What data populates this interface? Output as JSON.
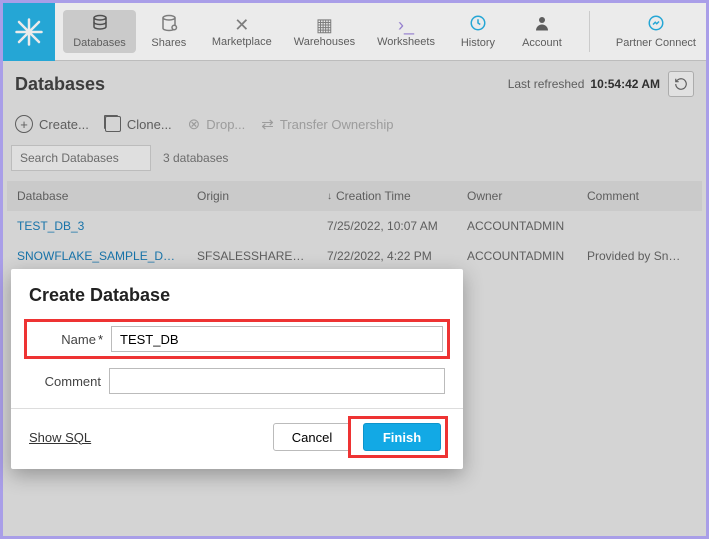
{
  "nav": {
    "items": [
      {
        "label": "Databases",
        "icon": "database-icon",
        "active": true
      },
      {
        "label": "Shares",
        "icon": "share-icon"
      },
      {
        "label": "Marketplace",
        "icon": "marketplace-icon"
      },
      {
        "label": "Warehouses",
        "icon": "warehouse-icon"
      },
      {
        "label": "Worksheets",
        "icon": "worksheet-icon"
      },
      {
        "label": "History",
        "icon": "history-icon"
      },
      {
        "label": "Account",
        "icon": "account-icon"
      }
    ],
    "partner": {
      "label": "Partner Connect"
    }
  },
  "header": {
    "title": "Databases",
    "last_refreshed_label": "Last refreshed",
    "last_refreshed_time": "10:54:42 AM"
  },
  "toolbar": {
    "create": "Create...",
    "clone": "Clone...",
    "drop": "Drop...",
    "transfer": "Transfer Ownership"
  },
  "search": {
    "placeholder": "Search Databases",
    "count_label": "3 databases"
  },
  "table": {
    "columns": {
      "database": "Database",
      "origin": "Origin",
      "creation_time": "Creation Time",
      "owner": "Owner",
      "comment": "Comment"
    },
    "rows": [
      {
        "database": "TEST_DB_3",
        "origin": "",
        "creation_time": "7/25/2022, 10:07 AM",
        "owner": "ACCOUNTADMIN",
        "comment": ""
      },
      {
        "database": "SNOWFLAKE_SAMPLE_DATA",
        "origin": "SFSALESSHARED.S...",
        "creation_time": "7/22/2022, 4:22 PM",
        "owner": "ACCOUNTADMIN",
        "comment": "Provided by Snowflak..."
      }
    ]
  },
  "modal": {
    "title": "Create Database",
    "name_label": "Name",
    "name_value": "TEST_DB",
    "comment_label": "Comment",
    "comment_value": "",
    "show_sql": "Show SQL",
    "cancel": "Cancel",
    "finish": "Finish"
  }
}
